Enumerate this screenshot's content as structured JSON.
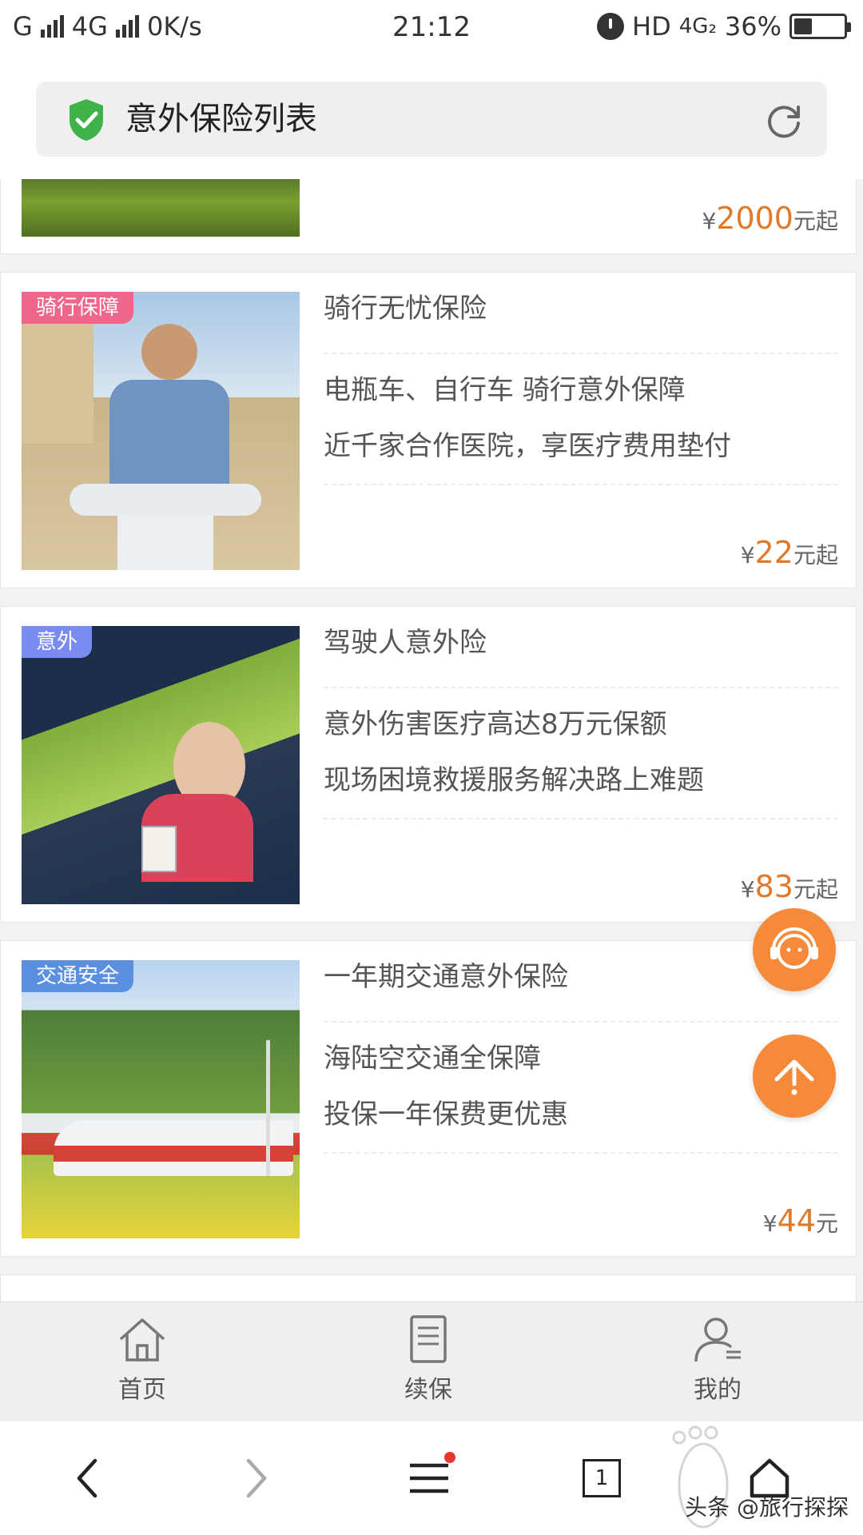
{
  "status_bar": {
    "carrier_1": "G",
    "carrier_2": "4G",
    "speed": "0K/s",
    "time": "21:12",
    "hd": "HD",
    "network": "4G₂",
    "battery": "36%",
    "battery_level": 0.36
  },
  "address_bar": {
    "title": "意外保险列表"
  },
  "products": [
    {
      "price_symbol": "¥",
      "price": "2000",
      "price_suffix": "元起"
    },
    {
      "tag": "骑行保障",
      "tag_color": "#f0668a",
      "title": "骑行无忧保险",
      "desc_1": "电瓶车、自行车 骑行意外保障",
      "desc_2": "近千家合作医院，享医疗费用垫付",
      "price_symbol": "¥",
      "price": "22",
      "price_suffix": "元起"
    },
    {
      "tag": "意外",
      "tag_color": "#7b8cf0",
      "title": "驾驶人意外险",
      "desc_1": "意外伤害医疗高达8万元保额",
      "desc_2": "现场困境救援服务解决路上难题",
      "price_symbol": "¥",
      "price": "83",
      "price_suffix": "元起"
    },
    {
      "tag": "交通安全",
      "tag_color": "#5b8fe0",
      "title": "一年期交通意外保险",
      "desc_1": "海陆空交通全保障",
      "desc_2": "投保一年保费更优惠",
      "price_symbol": "¥",
      "price": "44",
      "price_suffix": "元"
    }
  ],
  "site_nav": {
    "home": "首页",
    "renew": "续保",
    "mine": "我的"
  },
  "browser_bar": {
    "tab_count": "1"
  },
  "watermark": "头条 @旅行探探",
  "colors": {
    "accent": "#f58a3a",
    "price": "#e07a2a",
    "shield": "#3fb24a"
  }
}
